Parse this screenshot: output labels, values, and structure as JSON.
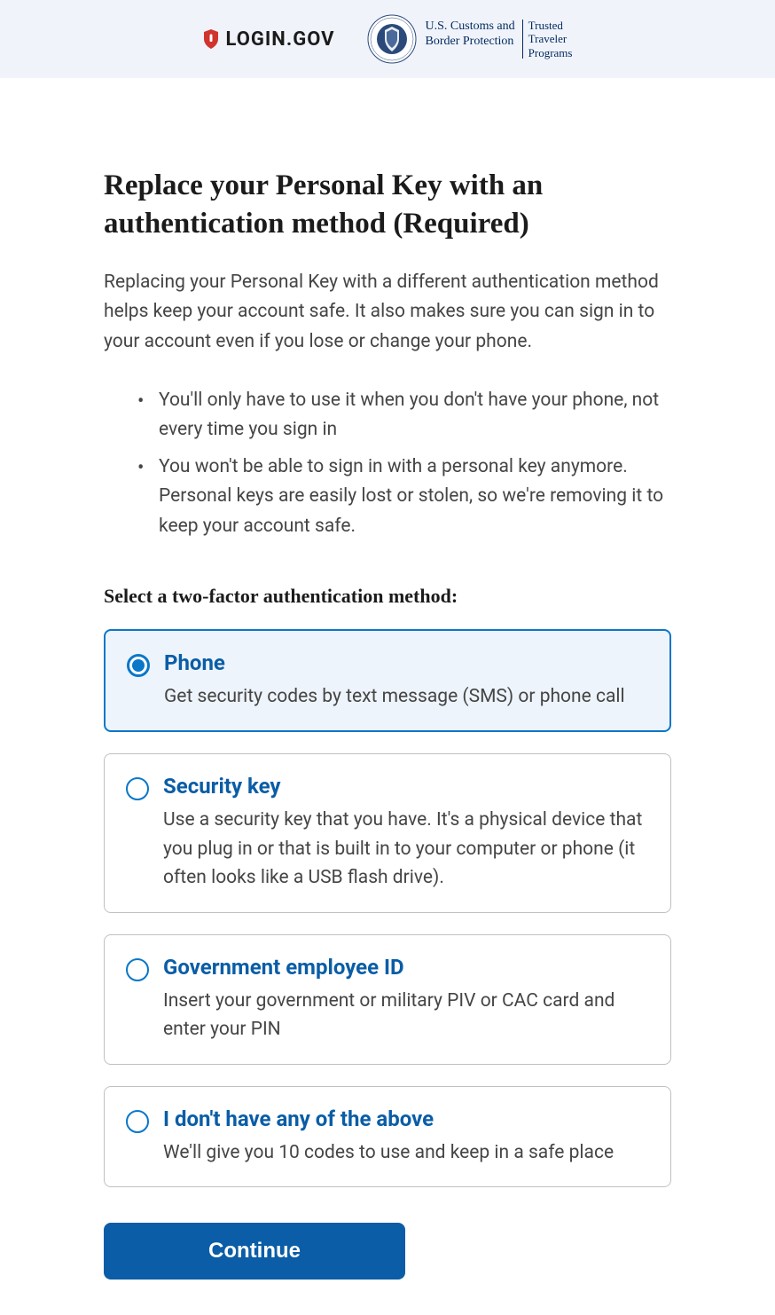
{
  "header": {
    "login_gov_label": "LOGIN.GOV",
    "cbp_line1": "U.S. Customs and",
    "cbp_line2": "Border Protection",
    "ttp_line1": "Trusted",
    "ttp_line2": "Traveler",
    "ttp_line3": "Programs"
  },
  "main": {
    "title": "Replace your Personal Key with an authentication method (Required)",
    "intro": "Replacing your Personal Key with a different authentication method helps keep your account safe. It also makes sure you can sign in to your account even if you lose or change your phone.",
    "bullets": [
      "You'll only have to use it when you don't have your phone, not every time you sign in",
      "You won't be able to sign in with a personal key anymore. Personal keys are easily lost or stolen, so we're removing it to keep your account safe."
    ],
    "section_label": "Select a two-factor authentication method:",
    "options": [
      {
        "title": "Phone",
        "desc": "Get security codes by text message (SMS) or phone call",
        "selected": true
      },
      {
        "title": "Security key",
        "desc": "Use a security key that you have. It's a physical device that you plug in or that is built in to your computer or phone (it often looks like a USB flash drive).",
        "selected": false
      },
      {
        "title": "Government employee ID",
        "desc": "Insert your government or military PIV or CAC card and enter your PIN",
        "selected": false
      },
      {
        "title": "I don't have any of the above",
        "desc": "We'll give you 10 codes to use and keep in a safe place",
        "selected": false
      }
    ],
    "continue_label": "Continue"
  }
}
